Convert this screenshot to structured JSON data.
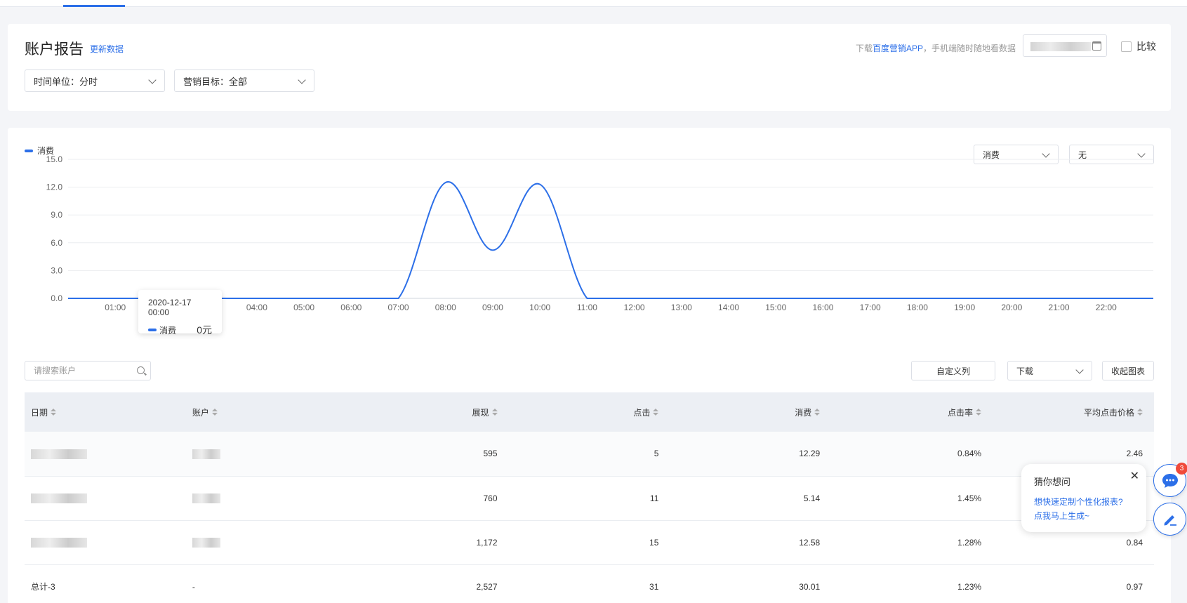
{
  "header": {
    "title": "账户报告",
    "refresh_label": "更新数据",
    "app_tip_prefix": "下载",
    "app_tip_link": "百度营销APP",
    "app_tip_suffix": "，手机端随时随地看数据",
    "compare_label": "比较"
  },
  "filters": {
    "time_unit": "时间单位：分时",
    "goal": "营销目标：全部"
  },
  "chart_controls": {
    "legend_label": "消费",
    "metric_select": "消费",
    "compare_metric_select": "无"
  },
  "chart_data": {
    "type": "line",
    "title": "",
    "xlabel": "",
    "ylabel": "",
    "ylim": [
      0,
      15
    ],
    "y_ticks": [
      "15.0",
      "12.0",
      "9.0",
      "6.0",
      "3.0",
      "0.0"
    ],
    "x_ticks": [
      "01:00",
      "02:00",
      "03:00",
      "04:00",
      "05:00",
      "06:00",
      "07:00",
      "08:00",
      "09:00",
      "10:00",
      "11:00",
      "12:00",
      "13:00",
      "14:00",
      "15:00",
      "16:00",
      "17:00",
      "18:00",
      "19:00",
      "20:00",
      "21:00",
      "22:00"
    ],
    "grid": true,
    "legend": "top-left",
    "color": "#2c6fe8",
    "series": [
      {
        "name": "消费",
        "x": [
          0,
          1,
          2,
          3,
          4,
          5,
          6,
          7,
          8,
          9,
          10,
          11,
          12,
          13,
          14,
          15,
          16,
          17,
          18,
          19,
          20,
          21,
          22,
          23
        ],
        "values": [
          0,
          0,
          0,
          0,
          0,
          0,
          0,
          0,
          12.5,
          5.2,
          12.3,
          0,
          0,
          0,
          0,
          0,
          0,
          0,
          0,
          0,
          0,
          0,
          0,
          0
        ]
      }
    ],
    "tooltip": {
      "date": "2020-12-17 00:00",
      "label": "消费",
      "value": "0元"
    }
  },
  "table_controls": {
    "search_placeholder": "请搜索账户",
    "custom_columns": "自定义列",
    "download": "下载",
    "collapse_chart": "收起图表"
  },
  "table": {
    "columns": [
      "日期",
      "账户",
      "展现",
      "点击",
      "消费",
      "点击率",
      "平均点击价格"
    ],
    "rows": [
      {
        "impressions": "595",
        "clicks": "5",
        "cost": "12.29",
        "ctr": "0.84%",
        "cpc": "2.46"
      },
      {
        "impressions": "760",
        "clicks": "11",
        "cost": "5.14",
        "ctr": "1.45%",
        "cpc": ""
      },
      {
        "impressions": "1,172",
        "clicks": "15",
        "cost": "12.58",
        "ctr": "1.28%",
        "cpc": "0.84"
      }
    ],
    "total": {
      "label": "总计-3",
      "account": "-",
      "impressions": "2,527",
      "clicks": "31",
      "cost": "30.01",
      "ctr": "1.23%",
      "cpc": "0.97"
    }
  },
  "chat_popup": {
    "title": "猜你想问",
    "link_line1": "想快速定制个性化报表?",
    "link_line2": "点我马上生成~",
    "badge_count": "3"
  }
}
